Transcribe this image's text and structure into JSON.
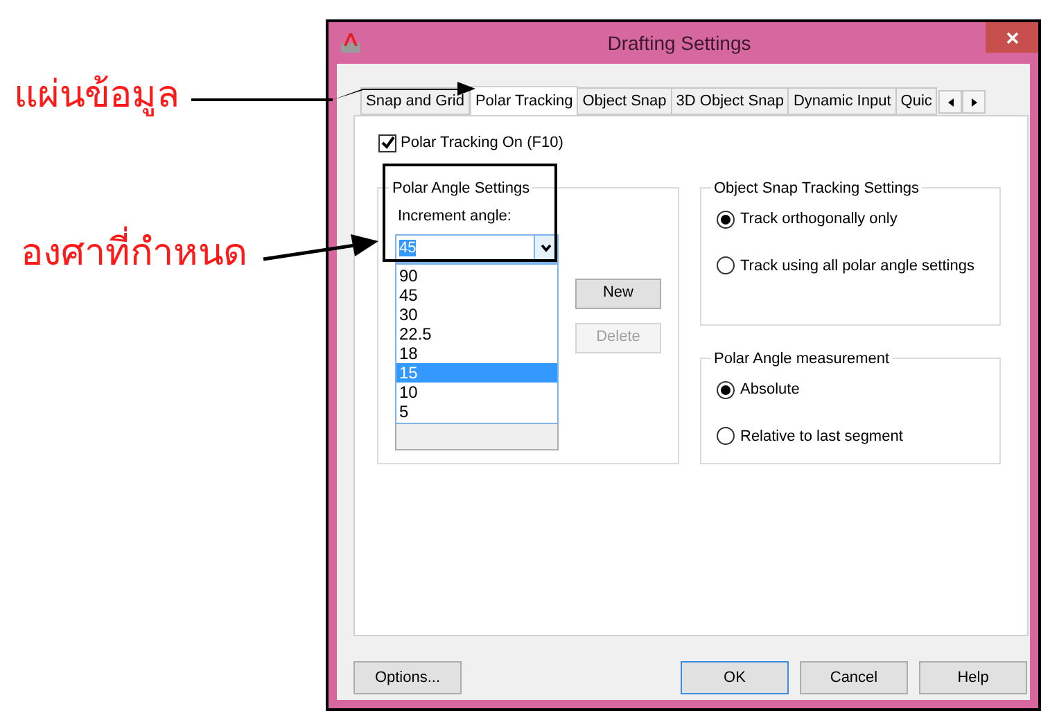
{
  "annotations": [
    {
      "text": "แผ่นข้อมูล"
    },
    {
      "text": "องศาที่กำหนด"
    }
  ],
  "window": {
    "title": "Drafting Settings"
  },
  "tabs": [
    {
      "label": "Snap and Grid",
      "selected": false
    },
    {
      "label": "Polar Tracking",
      "selected": true
    },
    {
      "label": "Object Snap",
      "selected": false
    },
    {
      "label": "3D Object Snap",
      "selected": false
    },
    {
      "label": "Dynamic Input",
      "selected": false
    },
    {
      "label": "Quic",
      "selected": false
    }
  ],
  "polar_on": {
    "label": "Polar Tracking On (F10)",
    "checked": true
  },
  "polar_angle_settings": {
    "title": "Polar Angle Settings",
    "increment_label": "Increment angle:",
    "increment_value": "45",
    "dropdown": [
      {
        "label": "90",
        "selected": false
      },
      {
        "label": "45",
        "selected": false
      },
      {
        "label": "30",
        "selected": false
      },
      {
        "label": "22.5",
        "selected": false
      },
      {
        "label": "18",
        "selected": false
      },
      {
        "label": "15",
        "selected": true
      },
      {
        "label": "10",
        "selected": false
      },
      {
        "label": "5",
        "selected": false
      }
    ],
    "buttons": [
      {
        "label": "New",
        "disabled": false
      },
      {
        "label": "Delete",
        "disabled": true
      }
    ]
  },
  "object_snap_tracking": {
    "title": "Object Snap Tracking Settings",
    "options": [
      {
        "label": "Track orthogonally only",
        "selected": true
      },
      {
        "label": "Track using all polar angle settings",
        "selected": false
      }
    ]
  },
  "polar_angle_measurement": {
    "title": "Polar Angle measurement",
    "options": [
      {
        "label": "Absolute",
        "selected": true
      },
      {
        "label": "Relative to last segment",
        "selected": false
      }
    ]
  },
  "footer_buttons": [
    {
      "label": "Options...",
      "default": false
    },
    {
      "label": "OK",
      "default": true
    },
    {
      "label": "Cancel",
      "default": false
    },
    {
      "label": "Help",
      "default": false
    }
  ]
}
